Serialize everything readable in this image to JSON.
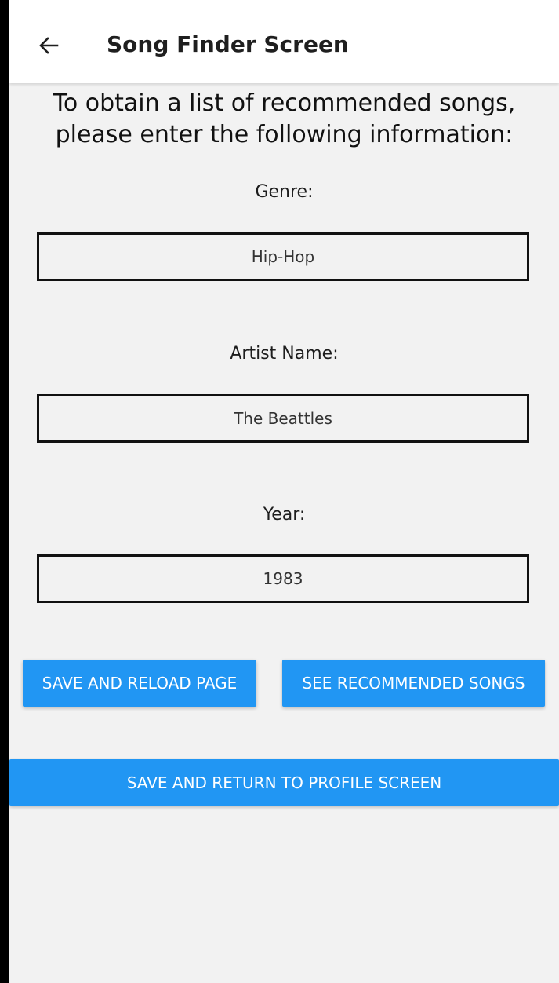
{
  "header": {
    "title": "Song Finder Screen"
  },
  "intro": {
    "line1": "To obtain a list of recommended songs,",
    "line2": "please enter the following information:"
  },
  "fields": {
    "genre": {
      "label": "Genre:",
      "value": "Hip-Hop"
    },
    "artist": {
      "label": "Artist Name:",
      "value": "The Beattles"
    },
    "year": {
      "label": "Year:",
      "value": "1983"
    }
  },
  "buttons": {
    "save_reload": "SAVE AND RELOAD PAGE",
    "see_recommended": "SEE RECOMMENDED SONGS",
    "save_return": "SAVE AND RETURN TO PROFILE SCREEN"
  },
  "icons": {
    "back": "arrow-left-icon"
  },
  "colors": {
    "accent": "#2196f3",
    "background": "#f2f2f2",
    "appbar": "#ffffff",
    "frame": "#000000"
  }
}
